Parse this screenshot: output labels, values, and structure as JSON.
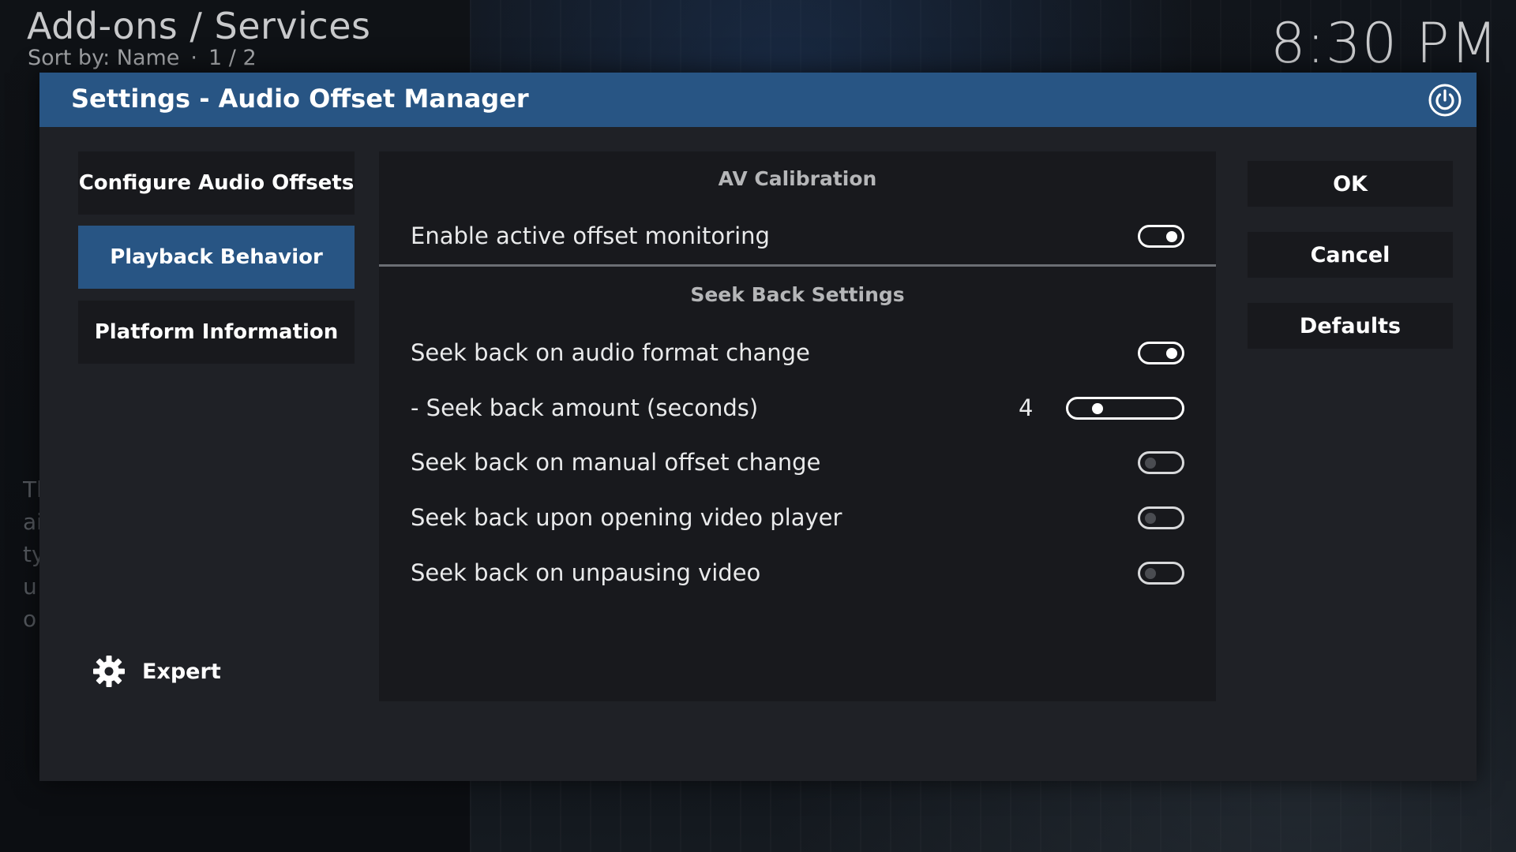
{
  "header": {
    "breadcrumb": "Add-ons / Services",
    "sort_label": "Sort by: Name",
    "separator": "·",
    "page_indicator": "1 / 2",
    "clock": "8:30 PM"
  },
  "background": {
    "partial_text": "Tl\nai\nty\nu:\no"
  },
  "dialog": {
    "title": "Settings - Audio Offset Manager",
    "close_icon": "power-icon",
    "categories": [
      {
        "label": "Configure Audio Offsets",
        "active": false
      },
      {
        "label": "Playback Behavior",
        "active": true
      },
      {
        "label": "Platform Information",
        "active": false
      }
    ],
    "settings_level": {
      "icon": "gear-icon",
      "label": "Expert"
    },
    "sections": [
      {
        "title": "AV Calibration",
        "items": [
          {
            "label": "Enable active offset monitoring",
            "type": "toggle",
            "on": true
          }
        ]
      },
      {
        "title": "Seek Back Settings",
        "items": [
          {
            "label": "Seek back on audio format change",
            "type": "toggle",
            "on": true
          },
          {
            "label": "- Seek back amount (seconds)",
            "type": "slider",
            "value": "4"
          },
          {
            "label": "Seek back on manual offset change",
            "type": "toggle",
            "on": false
          },
          {
            "label": "Seek back upon opening video player",
            "type": "toggle",
            "on": false
          },
          {
            "label": "Seek back on unpausing video",
            "type": "toggle",
            "on": false
          }
        ]
      }
    ],
    "buttons": {
      "ok": "OK",
      "cancel": "Cancel",
      "defaults": "Defaults"
    }
  },
  "colors": {
    "accent": "#285584",
    "dialog_bg": "#1f2126",
    "panel_bg": "#18191d"
  }
}
